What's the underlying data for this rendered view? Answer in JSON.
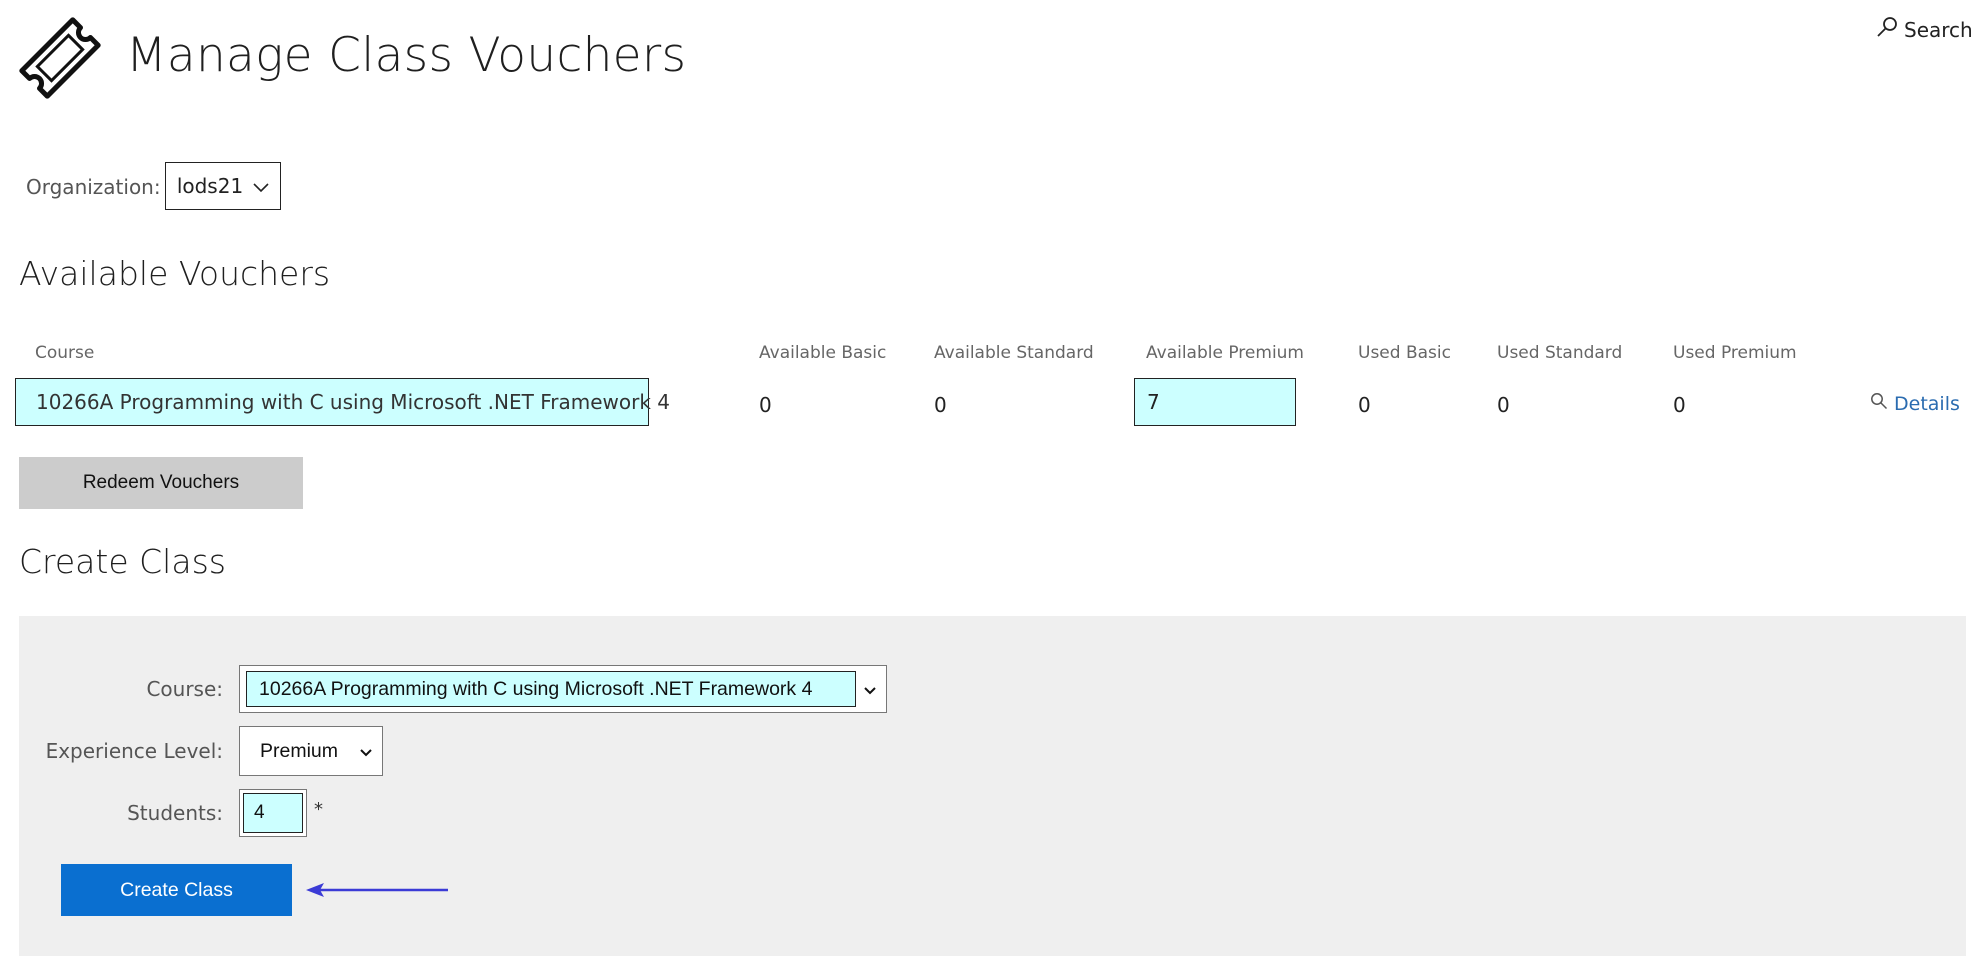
{
  "header": {
    "title": "Manage Class Vouchers",
    "search_label": "Search"
  },
  "organization": {
    "label": "Organization:",
    "selected": "lods21"
  },
  "vouchers": {
    "section_title": "Available Vouchers",
    "columns": {
      "course": "Course",
      "available_basic": "Available Basic",
      "available_standard": "Available Standard",
      "available_premium": "Available Premium",
      "used_basic": "Used Basic",
      "used_standard": "Used Standard",
      "used_premium": "Used Premium"
    },
    "rows": [
      {
        "course": "10266A Programming with C using Microsoft .NET Framework 4",
        "available_basic": "0",
        "available_standard": "0",
        "available_premium": "7",
        "used_basic": "0",
        "used_standard": "0",
        "used_premium": "0",
        "details_label": "Details"
      }
    ],
    "redeem_label": "Redeem Vouchers"
  },
  "create_class": {
    "section_title": "Create Class",
    "course_label": "Course:",
    "course_value": "10266A Programming with C using Microsoft .NET Framework 4",
    "experience_label": "Experience Level:",
    "experience_value": "Premium",
    "students_label": "Students:",
    "students_value": "4",
    "required_marker": "*",
    "submit_label": "Create Class"
  },
  "colors": {
    "highlight": "#ccffff",
    "primary_button": "#0a6fd0",
    "secondary_button": "#cccccc",
    "panel_background": "#efefef",
    "link": "#2b6cb0",
    "annotation_arrow": "#3b3bd6"
  },
  "icons": {
    "logo": "ticket-icon",
    "search": "search-icon",
    "details": "magnifier-icon",
    "dropdown": "chevron-down-icon"
  }
}
